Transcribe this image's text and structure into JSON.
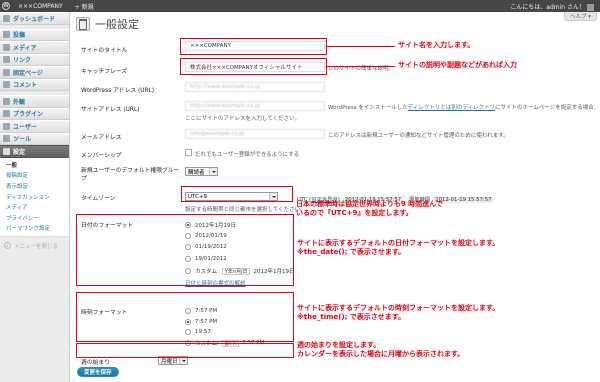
{
  "adminbar": {
    "site_name": "×××COMPANY",
    "new_label": "+ 新規",
    "greeting": "こんにちは、admin さん！"
  },
  "sidebar": {
    "items": [
      {
        "label": "ダッシュボード"
      },
      {
        "label": "投稿"
      },
      {
        "label": "メディア"
      },
      {
        "label": "リンク"
      },
      {
        "label": "固定ページ"
      },
      {
        "label": "コメント"
      },
      {
        "label": "外観"
      },
      {
        "label": "プラグイン"
      },
      {
        "label": "ユーザー"
      },
      {
        "label": "ツール"
      },
      {
        "label": "設定"
      }
    ],
    "submenu": [
      "一般",
      "投稿設定",
      "表示設定",
      "ディスカッション",
      "メディア",
      "プライバシー",
      "パーマリンク設定"
    ],
    "collapse_label": "メニューを閉じる"
  },
  "header": {
    "title": "一般設定",
    "help_label": "ヘルプ ▾"
  },
  "form": {
    "site_title": {
      "label": "サイトのタイトル",
      "value": "×××COMPANY"
    },
    "tagline": {
      "label": "キャッチフレーズ",
      "value": "株式会社×××COMPANYオフィシャルサイト",
      "desc": "このサイトの簡単な説明。"
    },
    "wp_address": {
      "label": "WordPress アドレス (URL)",
      "value": "http://www.example.co.jp"
    },
    "site_address": {
      "label": "サイトアドレス (URL)",
      "value": "http://www.example.co.jp",
      "desc_line1_pre": "WordPress をインストールした",
      "desc_line1_link": "ディレクトリとは別のディレクトリ",
      "desc_line1_post": "にサイトのホームページを設定する場合、",
      "desc_line2": "ここにサイトのアドレスを入力してください。"
    },
    "email": {
      "label": "メールアドレス",
      "value": "info@example.co.jp",
      "desc": "このアドレスは新規ユーザーの通知などサイト管理のために使われます。"
    },
    "membership": {
      "label": "メンバーシップ",
      "checkbox_label": "だれでもユーザー登録ができるようにする"
    },
    "default_role": {
      "label": "新規ユーザーのデフォルト権限グループ",
      "value": "購読者"
    },
    "timezone": {
      "label": "タイムゾーン",
      "value": "UTC+9",
      "desc": "設定する時間帯と同じ都市を選択してください。",
      "utc_pre": "UTC (",
      "utc_link": "協定世界時",
      "utc_post": ")",
      "utc_time": "2012-01-19 15:57:57",
      "local_label": "現地時間",
      "local_time": "2012-01-19 15:57:57"
    },
    "date_format": {
      "label": "日付のフォーマット",
      "options": [
        "2012年1月19日",
        "2012/01/19",
        "01/19/2012",
        "19/01/2012"
      ],
      "custom_label": "カスタム:",
      "custom_value": "Y年n月j日",
      "custom_preview": "2012年1月19日",
      "doc_link": "日付と時刻の書式の解説"
    },
    "time_format": {
      "label": "時刻フォーマット",
      "options": [
        "7:57 PM",
        "7:57 PM",
        "19:57"
      ],
      "custom_label": "カスタム:",
      "custom_value": "g:i A",
      "custom_preview": "7:57 PM"
    },
    "week_start": {
      "label": "週の始まり",
      "value": "月曜日"
    }
  },
  "notes": {
    "site_title": "サイト名を入力します。",
    "tagline": "サイトの説明や副題などがあれば入力",
    "timezone_1": "日本の標準時は協定世界時よりも9 時間進んで",
    "timezone_2": "いるので『UTC+9』を設定します。",
    "date_1": "サイトに表示するデフォルトの日付フォーマットを設定します。",
    "date_2": "※the_date(); で表示させます。",
    "time_1": "サイトに表示するデフォルトの時刻フォーマットを設定します。",
    "time_2": "※the_time(); で表示させます。",
    "week_1": "週の始まりを設定します。",
    "week_2": "カレンダーを表示した場合に月曜から表示されます。"
  },
  "save_label": "変更を保存",
  "colors": {
    "accent": "#21759b",
    "annotation": "#e60012",
    "adminbar": "#464646"
  }
}
